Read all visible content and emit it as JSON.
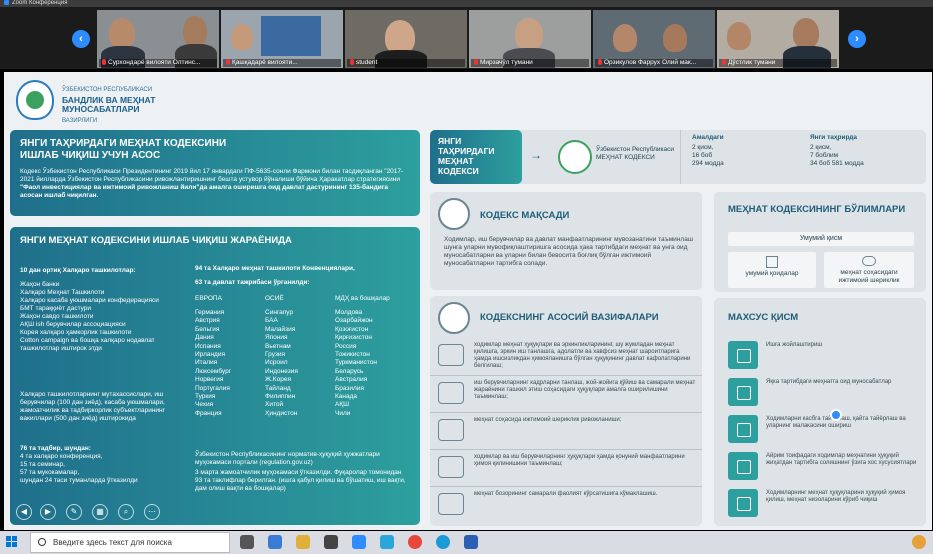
{
  "window": {
    "title": "Zoom Конференция"
  },
  "participants": [
    {
      "name": "Сурхондарё вилояти Олтинс..."
    },
    {
      "name": "Қашқадарё вилояти..."
    },
    {
      "name": "student"
    },
    {
      "name": "Мирзачўл тумани"
    },
    {
      "name": "Орзикулов Фаррух Олий мак..."
    },
    {
      "name": "Дўстлик тумани"
    }
  ],
  "nav": {
    "prev": "‹",
    "next": "›"
  },
  "logo": {
    "line1": "ЎЗБЕКИСТОН РЕСПУБЛИКАСИ",
    "line2": "БАНДЛИК ВА МЕҲНАТ МУНОСАБАТЛАРИ",
    "line3": "ВАЗИРЛИГИ"
  },
  "intro": {
    "title": "ЯНГИ ТАҲРИРДАГИ МЕҲНАТ КОДЕКСИНИ ИШЛАБ ЧИҚИШ УЧУН АСОС",
    "p1": "Кодекс Ўзбекистон Республикаси Президентининг 2019 йил 17 январдаги ПФ-5635-сонли Фармони билан тасдиқланган \"2017-2021 йилларда Ўзбекистон Республикасини ривожлантиришнинг бешта устувор йўналиши бўйича Ҳаракатлар стратегиясини",
    "p2": "\"Фаол инвестициялар ва ижтимоий ривожланиш йили\"да амалга оширишга оид давлат дастурининг 135-бандига асосан ишлаб чиқилган."
  },
  "process": {
    "title": "ЯНГИ МЕҲНАТ КОДЕКСИНИ ИШЛАБ ЧИҚИШ ЖАРАЁНИДА",
    "orgs_title": "10 дан ортиқ Халқаро ташкилотлар:",
    "orgs": [
      "Жаҳон банки",
      "Халқаро Меҳнат Ташкилоти",
      "Халқаро касаба уюшмалари конфедерацияси",
      "БМТ тараққиёт дастури",
      "Жаҳон савдо ташкилоти",
      "АҚШ ish берувчилар ассоциацияси",
      "Корея халқаро ҳамкорлик ташкилоти",
      "Cotton campaign ва бошқа халқаро нодавлат ташкилотлар иштирок этди"
    ],
    "exp": "Халқаро ташкилотларнинг мутахассислари, иш берувчилар (100 дан зиёд), касаба уюшмалари, жамоатчилик ва тадбиркорлик субъектларининг вакиллари (500 дан зиёд) иштирокида",
    "events": [
      "76 та тадбир, шундан:",
      "4 та халқаро конференция,",
      "15 та семинар,",
      "57 та мукокамалар,",
      "шундан 24 таси туманларда ўтказилди"
    ],
    "conv": "94 та Халқаро меҳнат ташкилоти Конвенциялари,",
    "states": "63 та давлат тажрибаси ўрганилди:",
    "regions": [
      "ЕВРОПА",
      "ОСИЁ",
      "МДҲ ва бошқалар"
    ],
    "col1": [
      "Германия",
      "Австрия",
      "Бельгия",
      "Дания",
      "Испания",
      "Ирландия",
      "Италия",
      "Люксембург",
      "Норвегия",
      "Португалия",
      "Туркия",
      "Чехия",
      "Франция"
    ],
    "col2": [
      "Сингапур",
      "БАА",
      "Малайзия",
      "Япония",
      "Вьетнам",
      "Грузия",
      "Исроил",
      "Индонезия",
      "Ж.Корея",
      "Тайланд",
      "Филиппин",
      "Хитой",
      "Ҳиндистон"
    ],
    "col3": [
      "Молдова",
      "Озарбайжон",
      "Қозоғистон",
      "Қирғизистон",
      "Россия",
      "Тожикистон",
      "Туркманистон",
      "Беларусь",
      "Австралия",
      "Бразилия",
      "Канада",
      "АҚШ",
      "Чили"
    ],
    "portal": "Ўзбекистон Республикасининг норматив-ҳуқуқий ҳужжатлари муҳокамаси портали (regulation.gov.uz)",
    "public": "3 марта жамоатчилик муҳокамаси ўтказилди. Фуқаролар томонидан",
    "proposals": "93 та таклифлар берилган. (ишга қабул қилиш ва бўшатиш, иш вақти, дам олиш вақти ва бошқалар)"
  },
  "compare": {
    "title": "ЯНГИ ТАҲРИРДАГИ МЕҲНАТ КОДЕКСИ",
    "emblem": "Ўзбекистон Республикаси МЕҲНАТ КОДЕКСИ",
    "current_h": "Амалдаги",
    "current": [
      "2 қисм,",
      "16 боб",
      "294 модда"
    ],
    "new_h": "Янги таҳрирда",
    "new": [
      "2 қисм,",
      "7 боблим",
      "34 боб 581 модда"
    ]
  },
  "goal": {
    "title": "КОДЕКС МАҚСАДИ",
    "text": "Ходимлар, иш берувчилар ва давлат манфаатларининг мувозанатини таъминлаш шунга уларни мувофиқлаштиришга асосида ҳака тартибдаги меҳнат ва унга оид муносабатларни ва уларни билан бевосита боғлиқ бўлган ижтимоий муносабатларни тартибга солади."
  },
  "tasks": {
    "title": "КОДЕКСНИНГ АСОСИЙ ВАЗИФАЛАРИ",
    "items": [
      "ходимлар меҳнат ҳуқуқлари ва эркинликларининг, шу жумладан меҳнат қилишга, эркин иш танлашга, адолатли ва хавфсиз меҳнат шароитларига ҳамда ишсизликдан ҳимояланишга бўлган ҳуқуқининг давлат кафолатларини белгилаш;",
      "иш берувчиларнинг кадрларни танлаш, жой-жойига қўйиш ва самарали меҳнат жараёнини ташкил этиш соҳасидаги ҳуқуқлари амалга оширилишини таъминлаш;",
      "меҳнат соҳасида ижтимоий шериклик ривожланиши;",
      "ходимлар ва иш берувчиларнинг ҳуқуқлари ҳамда қонуний манфаатларини ҳимоя қилинишини таъминлаш;",
      "меҳнат бозорининг самарали фаолият кўрсатишига кўмаклашиш."
    ]
  },
  "parts": {
    "title": "МЕҲНАТ КОДЕКСИНИНГ БЎЛИМЛАРИ",
    "general": "Умумий қисм",
    "sub1": "умумий қоидалар",
    "sub2": "меҳнат соҳасидаги ижтимоий шериклик"
  },
  "special": {
    "title": "МАХСУС ҚИСМ",
    "items": [
      "Ишга жойлаштириш",
      "Яқка тартибдаги меҳнатга оид муносабатлар",
      "Ходимларни касбга тайёрлаш, қайта тайёрлаш ва уларнинг малакасини ошириш",
      "Айрим тоифадаги ходимлар меҳнатини ҳуқуқий жиҳатдан тартибга солишнинг ўзига хос хусусиятлари",
      "Ходимларнинг меҳнат ҳуқуқларини ҳуқуқий ҳимоя қилиш, меҳнат низоларини кўриб чиқиш"
    ]
  },
  "taskbar": {
    "search_placeholder": "Введите здесь текст для поиска"
  }
}
